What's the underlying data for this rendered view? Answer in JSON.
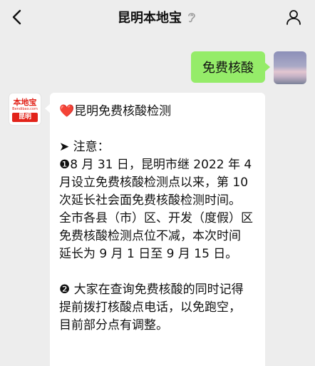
{
  "header": {
    "title": "昆明本地宝",
    "back_icon": "chevron-left-icon",
    "mute_icon": "ear-icon",
    "profile_icon": "person-icon"
  },
  "messages": {
    "outgoing": {
      "text": "免费核酸",
      "bubble_color": "#95ec69"
    },
    "incoming": {
      "avatar": {
        "brand": "本地宝",
        "brand_sub": "Bendibao.com",
        "tag": "昆明"
      },
      "lines": [
        "❤️昆明免费核酸检测",
        "",
        "➤ 注意：",
        "❶8 月 31 日，昆明市继 2022 年 4",
        "月设立免费核酸检测点以来，第 10",
        "次延长社会面免费核酸检测时间。",
        "全市各县（市）区、开发（度假）区",
        "免费核酸检测点位不减，本次时间",
        "延长为 9 月 1 日至 9 月 15 日。",
        "",
        "❷ 大家在查询免费核酸的同时记得",
        "提前拨打核酸点电话，以免跑空，",
        "目前部分点有调整。"
      ]
    }
  },
  "colors": {
    "background": "#ededed",
    "brand_red": "#e2231a"
  }
}
